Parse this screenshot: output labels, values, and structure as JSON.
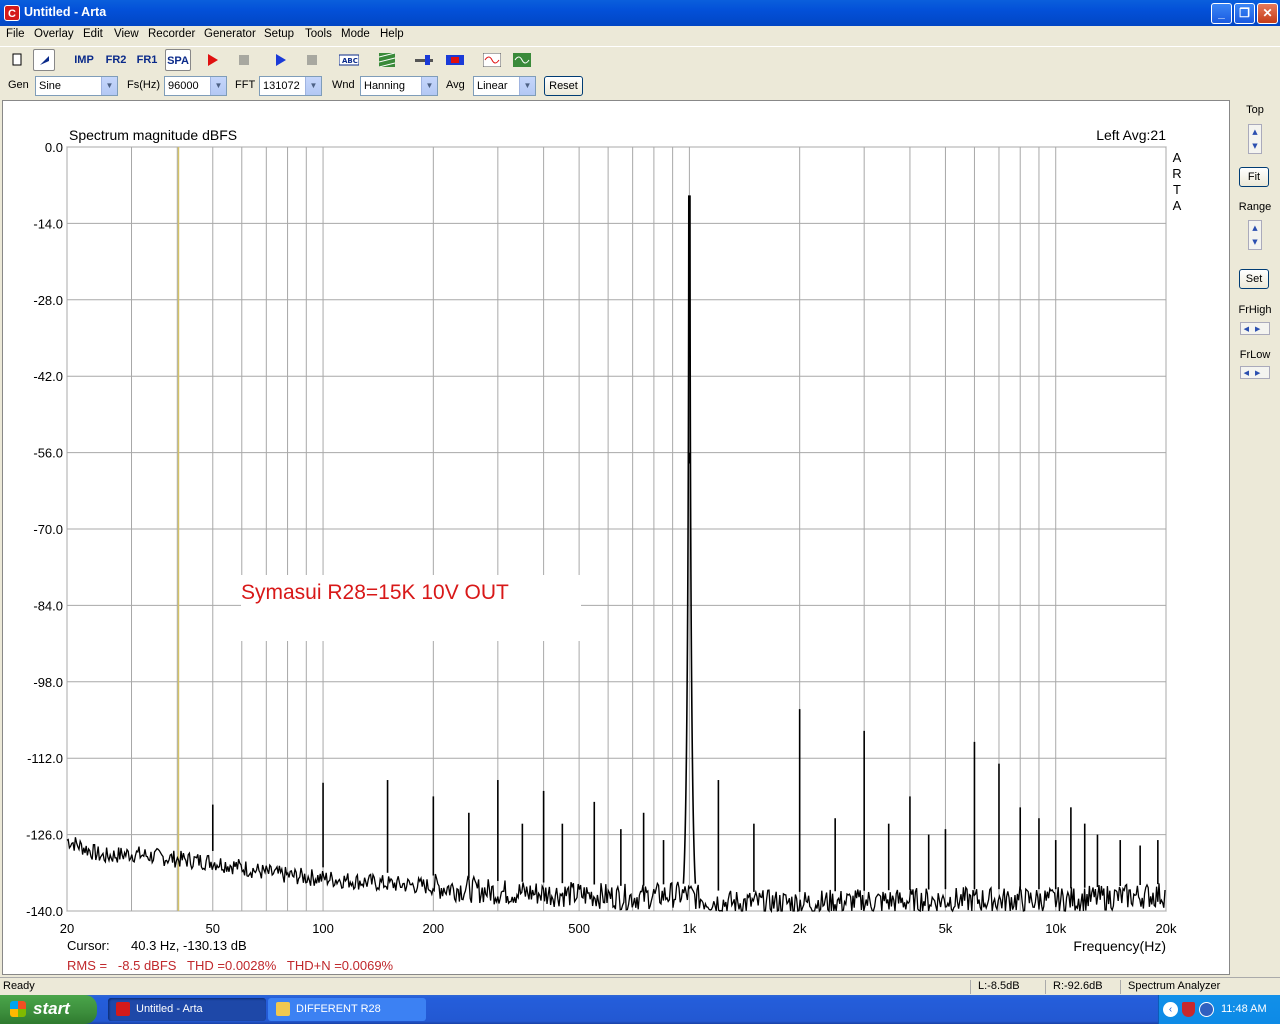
{
  "window": {
    "title": "Untitled - Arta",
    "app_icon_glyph": "C"
  },
  "menu": [
    "File",
    "Overlay",
    "Edit",
    "View",
    "Recorder",
    "Generator",
    "Setup",
    "Tools",
    "Mode",
    "Help"
  ],
  "toolbar": {
    "imp_label": "IMP",
    "fr2_label": "FR2",
    "fr1_label": "FR1",
    "spa_label": "SPA",
    "icons": [
      "new-file-icon",
      "cursor-icon",
      "impulse-mode-icon",
      "fr2-mode-icon",
      "fr1-mode-icon",
      "spectrum-mode-icon",
      "record-play-icon",
      "record-stop-icon",
      "generator-play-icon",
      "generator-stop-icon",
      "annotate-abc-icon",
      "grid-icon",
      "slider-icon",
      "color-bar-icon",
      "sine-wave-icon",
      "green-wave-icon"
    ]
  },
  "controls": {
    "gen_label": "Gen",
    "gen_value": "Sine",
    "fs_label": "Fs(Hz)",
    "fs_value": "96000",
    "fft_label": "FFT",
    "fft_value": "131072",
    "wnd_label": "Wnd",
    "wnd_value": "Hanning",
    "avg_label": "Avg",
    "avg_value": "Linear",
    "reset_label": "Reset"
  },
  "right_panel": {
    "top_label": "Top",
    "fit_label": "Fit",
    "range_label": "Range",
    "set_label": "Set",
    "frhigh_label": "FrHigh",
    "frlow_label": "FrLow"
  },
  "plot": {
    "title": "Spectrum magnitude dBFS",
    "channel_info": "Left  Avg:21",
    "logo_letters": [
      "A",
      "R",
      "T",
      "A"
    ],
    "annotation": "Symasui R28=15K 10V OUT",
    "annotation_color": "#d81818",
    "cursor_line_color": "#d4c268",
    "cursor_label": "Cursor:",
    "cursor_value": "40.3 Hz, -130.13 dB",
    "summary": "RMS =   -8.5 dBFS   THD =0.0028%   THD+N =0.0069%",
    "summary_color": "#c0282c"
  },
  "chart_data": {
    "type": "line",
    "title": "Spectrum magnitude dBFS",
    "xlabel": "Frequency(Hz)",
    "ylabel": "",
    "x_scale": "log",
    "xlim": [
      20,
      20000
    ],
    "ylim": [
      -140,
      0
    ],
    "grid": true,
    "x_ticks": [
      {
        "v": 20,
        "t": "20"
      },
      {
        "v": 50,
        "t": "50"
      },
      {
        "v": 100,
        "t": "100"
      },
      {
        "v": 200,
        "t": "200"
      },
      {
        "v": 500,
        "t": "500"
      },
      {
        "v": 1000,
        "t": "1k"
      },
      {
        "v": 2000,
        "t": "2k"
      },
      {
        "v": 5000,
        "t": "5k"
      },
      {
        "v": 10000,
        "t": "10k"
      },
      {
        "v": 20000,
        "t": "20k"
      }
    ],
    "y_ticks": [
      {
        "v": 0,
        "t": "0.0"
      },
      {
        "v": -14,
        "t": "-14.0"
      },
      {
        "v": -28,
        "t": "-28.0"
      },
      {
        "v": -42,
        "t": "-42.0"
      },
      {
        "v": -56,
        "t": "-56.0"
      },
      {
        "v": -70,
        "t": "-70.0"
      },
      {
        "v": -84,
        "t": "-84.0"
      },
      {
        "v": -98,
        "t": "-98.0"
      },
      {
        "v": -112,
        "t": "-112.0"
      },
      {
        "v": -126,
        "t": "-126.0"
      },
      {
        "v": -140,
        "t": "-140.0"
      }
    ],
    "noise_floor": [
      [
        20,
        -127
      ],
      [
        25,
        -130
      ],
      [
        30,
        -129.5
      ],
      [
        40,
        -130.5
      ],
      [
        50,
        -131
      ],
      [
        60,
        -132
      ],
      [
        70,
        -133
      ],
      [
        80,
        -133.5
      ],
      [
        100,
        -134
      ],
      [
        150,
        -135
      ],
      [
        200,
        -135.5
      ],
      [
        300,
        -136.5
      ],
      [
        500,
        -137
      ],
      [
        700,
        -137.5
      ],
      [
        900,
        -137
      ],
      [
        1000,
        -137
      ],
      [
        1100,
        -138
      ],
      [
        1300,
        -138.5
      ],
      [
        2000,
        -138.5
      ],
      [
        5000,
        -138
      ],
      [
        10000,
        -138
      ],
      [
        20000,
        -137
      ]
    ],
    "peaks": [
      {
        "f": 1000,
        "db": -9
      },
      {
        "f": 50,
        "db": -120.5
      },
      {
        "f": 100,
        "db": -116.5
      },
      {
        "f": 150,
        "db": -116
      },
      {
        "f": 200,
        "db": -119
      },
      {
        "f": 250,
        "db": -122
      },
      {
        "f": 300,
        "db": -116
      },
      {
        "f": 350,
        "db": -124
      },
      {
        "f": 400,
        "db": -118
      },
      {
        "f": 450,
        "db": -124
      },
      {
        "f": 550,
        "db": -120
      },
      {
        "f": 650,
        "db": -125
      },
      {
        "f": 750,
        "db": -122
      },
      {
        "f": 850,
        "db": -127
      },
      {
        "f": 1200,
        "db": -116
      },
      {
        "f": 1500,
        "db": -124
      },
      {
        "f": 2000,
        "db": -103
      },
      {
        "f": 2500,
        "db": -123
      },
      {
        "f": 3000,
        "db": -107
      },
      {
        "f": 3500,
        "db": -124
      },
      {
        "f": 4000,
        "db": -119
      },
      {
        "f": 4500,
        "db": -126
      },
      {
        "f": 5000,
        "db": -125
      },
      {
        "f": 6000,
        "db": -109
      },
      {
        "f": 7000,
        "db": -113
      },
      {
        "f": 8000,
        "db": -121
      },
      {
        "f": 9000,
        "db": -123
      },
      {
        "f": 10000,
        "db": -127
      },
      {
        "f": 11000,
        "db": -121
      },
      {
        "f": 12000,
        "db": -124
      },
      {
        "f": 13000,
        "db": -126
      },
      {
        "f": 15000,
        "db": -127
      },
      {
        "f": 17000,
        "db": -128
      },
      {
        "f": 19000,
        "db": -127
      }
    ]
  },
  "status": {
    "ready": "Ready",
    "left": "L:-8.5dB",
    "right": "R:-92.6dB",
    "mode": "Spectrum Analyzer"
  },
  "taskbar": {
    "start": "start",
    "tasks": [
      {
        "label": "Untitled - Arta"
      },
      {
        "label": "DIFFERENT R28"
      }
    ],
    "clock": "11:48 AM"
  }
}
